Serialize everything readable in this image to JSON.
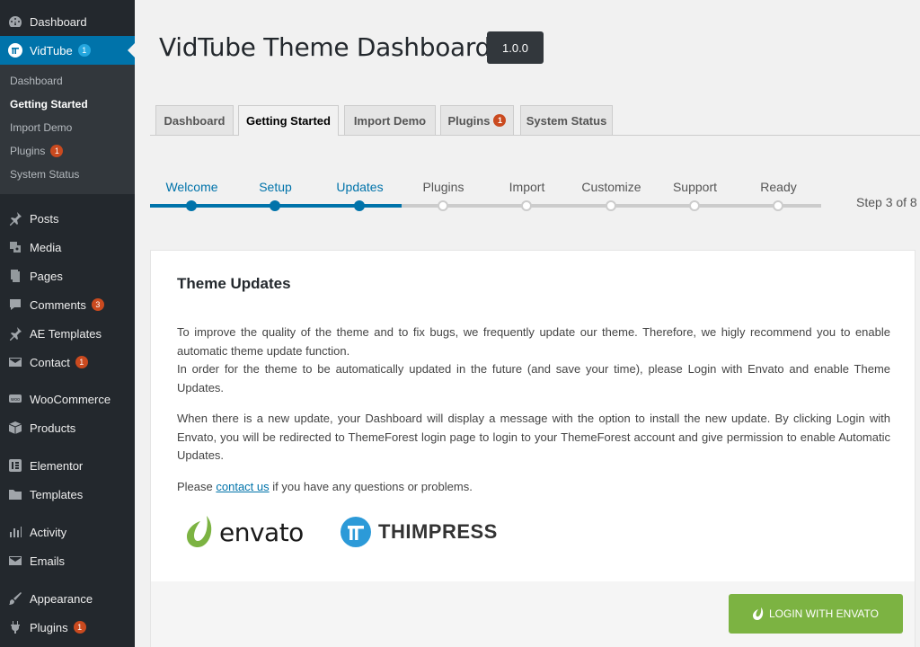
{
  "sidebar": {
    "items": [
      {
        "label": "Dashboard",
        "icon": "dashboard-icon"
      },
      {
        "label": "VidTube",
        "icon": "vidtube-icon",
        "badge": "1"
      },
      {
        "label": "Posts",
        "icon": "pin-icon"
      },
      {
        "label": "Media",
        "icon": "media-icon"
      },
      {
        "label": "Pages",
        "icon": "pages-icon"
      },
      {
        "label": "Comments",
        "icon": "comment-icon",
        "badge": "3"
      },
      {
        "label": "AE Templates",
        "icon": "pin-icon"
      },
      {
        "label": "Contact",
        "icon": "envelope-icon",
        "badge": "1"
      },
      {
        "label": "WooCommerce",
        "icon": "woo-icon"
      },
      {
        "label": "Products",
        "icon": "box-icon"
      },
      {
        "label": "Elementor",
        "icon": "elementor-icon"
      },
      {
        "label": "Templates",
        "icon": "folder-icon"
      },
      {
        "label": "Activity",
        "icon": "activity-icon"
      },
      {
        "label": "Emails",
        "icon": "envelope-icon"
      },
      {
        "label": "Appearance",
        "icon": "brush-icon"
      },
      {
        "label": "Plugins",
        "icon": "plug-icon",
        "badge": "1"
      }
    ],
    "submenu": [
      {
        "label": "Dashboard"
      },
      {
        "label": "Getting Started"
      },
      {
        "label": "Import Demo"
      },
      {
        "label": "Plugins",
        "badge": "1"
      },
      {
        "label": "System Status"
      }
    ]
  },
  "header": {
    "title": "VidTube Theme Dashboard",
    "version": "1.0.0"
  },
  "tabs": [
    {
      "label": "Dashboard"
    },
    {
      "label": "Getting Started"
    },
    {
      "label": "Import Demo"
    },
    {
      "label": "Plugins",
      "badge": "1"
    },
    {
      "label": "System Status"
    }
  ],
  "steps": {
    "items": [
      "Welcome",
      "Setup",
      "Updates",
      "Plugins",
      "Import",
      "Customize",
      "Support",
      "Ready"
    ],
    "current": 3,
    "counter": "Step 3 of 8"
  },
  "card": {
    "title": "Theme Updates",
    "p1a": "To improve the quality of the theme and to fix bugs, we frequently update our theme. Therefore, we higly recommend you to enable automatic theme update function.",
    "p1b": "In order for the theme to be automatically updated in the future (and save your time), please Login with Envato and enable Theme Updates.",
    "p2": "When there is a new update, your Dashboard will display a message with the option to install the new update. By clicking Login with Envato, you will be redirected to ThemeForest login page to login to your ThemeForest account and give permission to enable Automatic Updates.",
    "p3_before": "Please ",
    "p3_link": "contact us",
    "p3_after": " if you have any questions or problems.",
    "envato_word": "envato",
    "thim_word": "THIMPRESS",
    "login_button": "LOGIN WITH ENVATO"
  },
  "colors": {
    "sidebar_bg": "#23282d",
    "accent": "#0073aa",
    "badge": "#ca4a1f",
    "envato_green": "#7cb342"
  }
}
